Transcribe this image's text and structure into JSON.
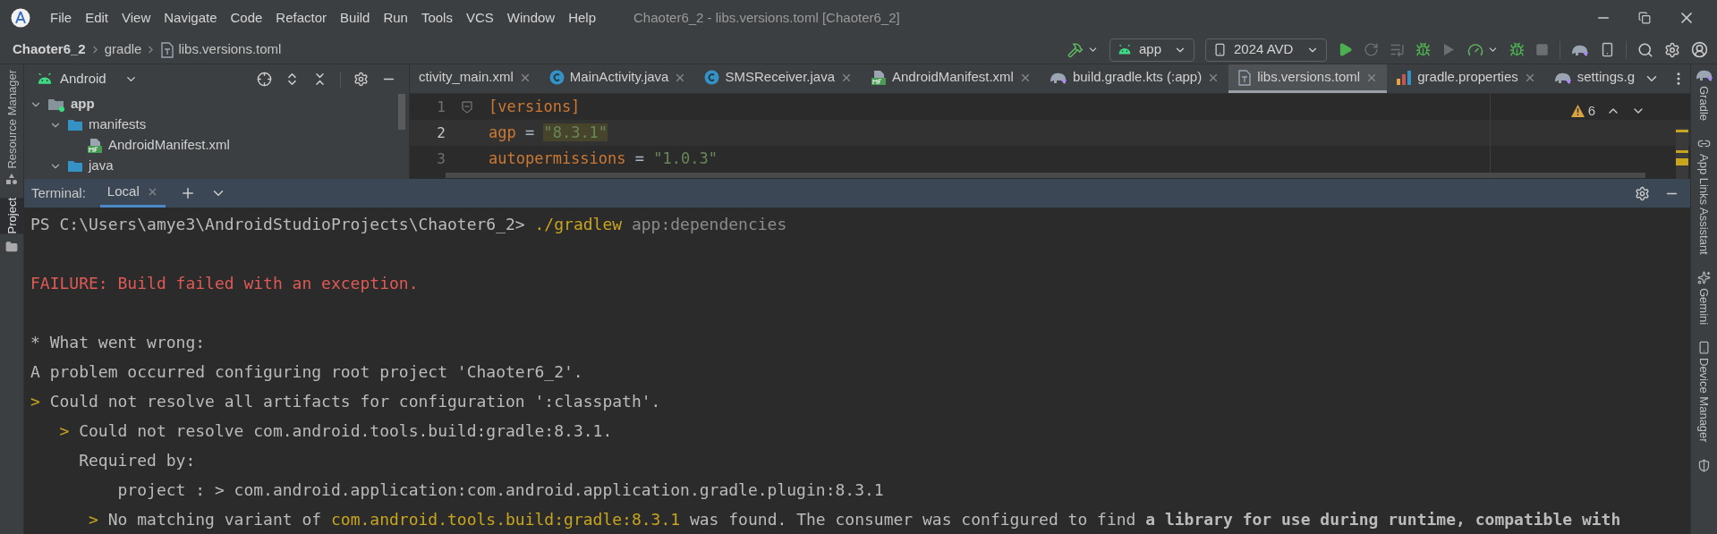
{
  "title_bar": {
    "menu": [
      "File",
      "Edit",
      "View",
      "Navigate",
      "Code",
      "Refactor",
      "Build",
      "Run",
      "Tools",
      "VCS",
      "Window",
      "Help"
    ],
    "title": "Chaoter6_2 - libs.versions.toml [Chaoter6_2]"
  },
  "nav_bar": {
    "breadcrumbs": [
      {
        "text": "Chaoter6_2",
        "kind": "project"
      },
      {
        "text": "gradle",
        "kind": "folder"
      },
      {
        "text": "libs.versions.toml",
        "kind": "file"
      }
    ],
    "run_config": "app",
    "device": "2024 AVD"
  },
  "left_strip": [
    {
      "label": "Resource Manager",
      "selected": false
    },
    {
      "label": "Project",
      "selected": true
    }
  ],
  "right_strip": [
    {
      "label": "Gradle",
      "kind": "gradle"
    },
    {
      "label": "App Links Assistant",
      "kind": "link"
    },
    {
      "label": "Gemini",
      "kind": "gemini"
    },
    {
      "label": "Device Manager",
      "kind": "device"
    }
  ],
  "project_panel": {
    "view": "Android",
    "tree": [
      {
        "label": "app",
        "kind": "module",
        "expanded": true,
        "children": [
          {
            "label": "manifests",
            "kind": "folder",
            "expanded": true,
            "children": [
              {
                "label": "AndroidManifest.xml",
                "kind": "manifest"
              }
            ]
          },
          {
            "label": "java",
            "kind": "folder",
            "expanded": true
          }
        ]
      }
    ]
  },
  "editor": {
    "tabs": [
      {
        "label": "ctivity_main.xml",
        "kind": "xml",
        "selected": false,
        "closable": true
      },
      {
        "label": "MainActivity.java",
        "kind": "java",
        "selected": false,
        "closable": true
      },
      {
        "label": "SMSReceiver.java",
        "kind": "java",
        "selected": false,
        "closable": true
      },
      {
        "label": "AndroidManifest.xml",
        "kind": "manifest",
        "selected": false,
        "closable": true
      },
      {
        "label": "build.gradle.kts (:app)",
        "kind": "gradle",
        "selected": false,
        "closable": true
      },
      {
        "label": "libs.versions.toml",
        "kind": "toml",
        "selected": true,
        "closable": true
      },
      {
        "label": "gradle.properties",
        "kind": "properties",
        "selected": false,
        "closable": true
      },
      {
        "label": "settings.g",
        "kind": "gradle",
        "selected": false,
        "closable": false
      }
    ],
    "warning_count": "6",
    "lines": [
      {
        "number": "1",
        "current": false,
        "tokens": [
          {
            "text": "[versions]",
            "kind": "section"
          }
        ]
      },
      {
        "number": "2",
        "current": true,
        "tokens": [
          {
            "text": "agp",
            "kind": "key"
          },
          {
            "text": " = ",
            "kind": "op"
          },
          {
            "text": "\"8.3.1\"",
            "kind": "marked-string"
          }
        ]
      },
      {
        "number": "3",
        "current": false,
        "tokens": [
          {
            "text": "autopermissions",
            "kind": "key"
          },
          {
            "text": " = ",
            "kind": "op"
          },
          {
            "text": "\"1.0.3\"",
            "kind": "string"
          }
        ]
      }
    ]
  },
  "terminal": {
    "label": "Terminal:",
    "tabs": [
      {
        "label": "Local",
        "selected": true
      }
    ],
    "lines": [
      {
        "kind": "text",
        "segments": [
          {
            "text": "PS C:\\Users\\amye3\\AndroidStudioProjects\\Chaoter6_2> ",
            "kind": "plain"
          },
          {
            "text": "./gradlew ",
            "kind": "accent"
          },
          {
            "text": "app:dependencies",
            "kind": "dim"
          }
        ]
      },
      {
        "kind": "blank"
      },
      {
        "kind": "text",
        "segments": [
          {
            "text": "FAILURE: Build failed with an exception.",
            "kind": "error"
          }
        ]
      },
      {
        "kind": "blank"
      },
      {
        "kind": "text",
        "segments": [
          {
            "text": "* What went wrong:",
            "kind": "plain"
          }
        ]
      },
      {
        "kind": "text",
        "segments": [
          {
            "text": "A problem occurred configuring root project 'Chaoter6_2'.",
            "kind": "plain"
          }
        ]
      },
      {
        "kind": "text",
        "segments": [
          {
            "text": ">",
            "kind": "accent"
          },
          {
            "text": " Could not resolve all artifacts for configuration ':classpath'.",
            "kind": "plain"
          }
        ]
      },
      {
        "kind": "text",
        "segments": [
          {
            "text": "   >",
            "kind": "accent"
          },
          {
            "text": " Could not resolve com.android.tools.build:gradle:8.3.1.",
            "kind": "plain"
          }
        ]
      },
      {
        "kind": "text",
        "segments": [
          {
            "text": "     Required by:",
            "kind": "plain"
          }
        ]
      },
      {
        "kind": "text",
        "segments": [
          {
            "text": "         project : > com.android.application:com.android.application.gradle.plugin:8.3.1",
            "kind": "plain"
          }
        ]
      },
      {
        "kind": "text",
        "segments": [
          {
            "text": "      >",
            "kind": "accent"
          },
          {
            "text": " No matching variant of ",
            "kind": "plain"
          },
          {
            "text": "com.android.tools.build:gradle:8.3.1",
            "kind": "accent"
          },
          {
            "text": " was found. The consumer was configured to find **a library for use during runtime, compatible with**",
            "kind": "plain"
          }
        ]
      }
    ]
  }
}
